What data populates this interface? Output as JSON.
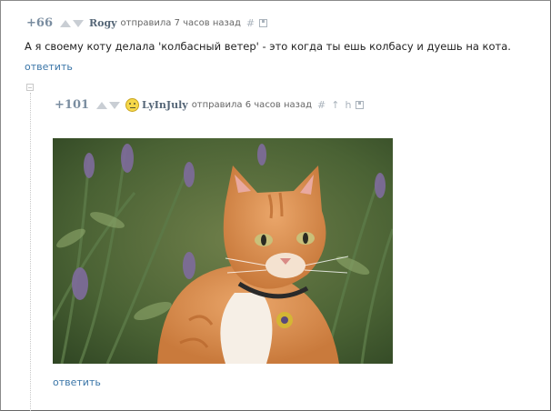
{
  "comment1": {
    "rating": "+66",
    "author": "Rogy",
    "sent": "отправила 7 часов назад",
    "permalink": "#",
    "text": "А я своему коту делала 'колбасный ветер' - это когда ты ешь колбасу и дуешь на кота.",
    "reply": "ответить"
  },
  "comment2": {
    "rating": "+101",
    "author": "LyInJuly",
    "sent": "отправила 6 часов назад",
    "permalink": "#",
    "parent": "↑",
    "branch": "h",
    "reply": "ответить"
  },
  "icons": [
    "arrow-up-icon",
    "arrow-down-icon",
    "save-icon",
    "avatar-icon",
    "collapse-icon"
  ]
}
